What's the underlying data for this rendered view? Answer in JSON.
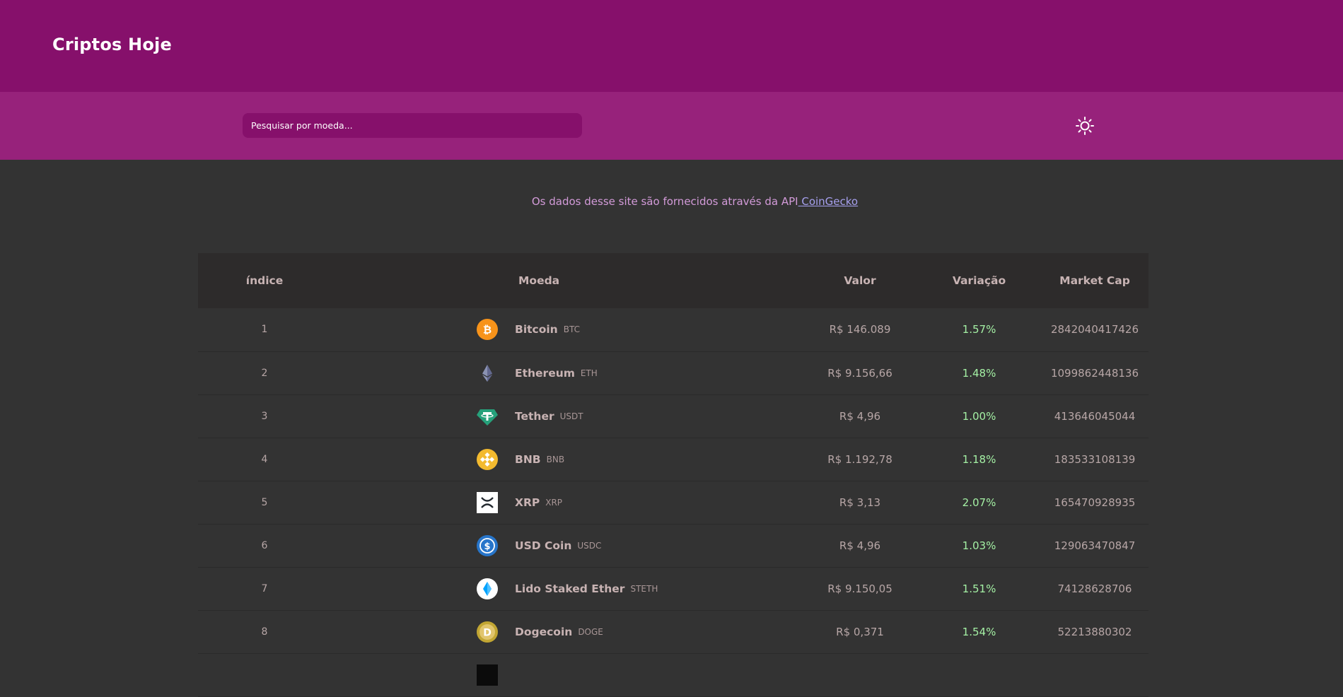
{
  "header": {
    "brand": "Criptos Hoje"
  },
  "search": {
    "placeholder": "Pesquisar por moeda..."
  },
  "credit": {
    "text": "Os dados desse site são fornecidos através da API",
    "link": " CoinGecko"
  },
  "table": {
    "columns": [
      "índice",
      "Moeda",
      "Valor",
      "Variação",
      "Market Cap"
    ],
    "rows": [
      {
        "index": "1",
        "name": "Bitcoin",
        "symbol": "BTC",
        "price": "R$ 146.089",
        "change": "1.57%",
        "market_cap": "2842040417426",
        "icon": "bitcoin-icon"
      },
      {
        "index": "2",
        "name": "Ethereum",
        "symbol": "ETH",
        "price": "R$ 9.156,66",
        "change": "1.48%",
        "market_cap": "1099862448136",
        "icon": "ethereum-icon"
      },
      {
        "index": "3",
        "name": "Tether",
        "symbol": "USDT",
        "price": "R$ 4,96",
        "change": "1.00%",
        "market_cap": "413646045044",
        "icon": "tether-icon"
      },
      {
        "index": "4",
        "name": "BNB",
        "symbol": "BNB",
        "price": "R$ 1.192,78",
        "change": "1.18%",
        "market_cap": "183533108139",
        "icon": "bnb-icon"
      },
      {
        "index": "5",
        "name": "XRP",
        "symbol": "XRP",
        "price": "R$ 3,13",
        "change": "2.07%",
        "market_cap": "165470928935",
        "icon": "xrp-icon"
      },
      {
        "index": "6",
        "name": "USD Coin",
        "symbol": "USDC",
        "price": "R$ 4,96",
        "change": "1.03%",
        "market_cap": "129063470847",
        "icon": "usdc-icon"
      },
      {
        "index": "7",
        "name": "Lido Staked Ether",
        "symbol": "STETH",
        "price": "R$ 9.150,05",
        "change": "1.51%",
        "market_cap": "74128628706",
        "icon": "lido-icon"
      },
      {
        "index": "8",
        "name": "Dogecoin",
        "symbol": "DOGE",
        "price": "R$ 0,371",
        "change": "1.54%",
        "market_cap": "52213880302",
        "icon": "dogecoin-icon"
      }
    ]
  },
  "colors": {
    "header_bg": "#86106b",
    "searchbar_bg": "#97227b",
    "page_bg": "#333333",
    "positive_change": "#a4f0a4"
  }
}
